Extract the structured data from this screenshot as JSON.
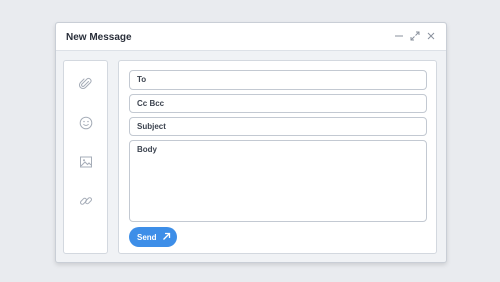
{
  "window": {
    "title": "New Message"
  },
  "controls": {
    "minimize_icon": "minimize-icon",
    "expand_icon": "expand-icon",
    "close_icon": "close-icon"
  },
  "sidebar": {
    "icons": [
      "paperclip-icon",
      "emoji-icon",
      "image-icon",
      "link-icon"
    ]
  },
  "form": {
    "to_label": "To",
    "cc_bcc_label": "Cc Bcc",
    "subject_label": "Subject",
    "body_label": "Body"
  },
  "send": {
    "label": "Send",
    "icon": "arrow-up-right-icon"
  },
  "colors": {
    "accent": "#3d8ee8",
    "background": "#e9ebef",
    "window": "#f0f2f5"
  }
}
